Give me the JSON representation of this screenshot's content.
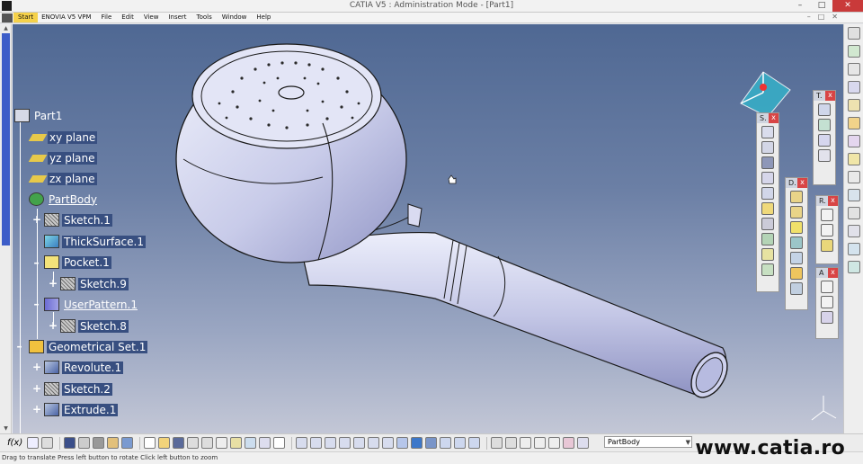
{
  "window": {
    "title": "CATIA V5 : Administration Mode - [Part1]"
  },
  "menu": {
    "items": [
      "Start",
      "ENOVIA V5 VPM",
      "File",
      "Edit",
      "View",
      "Insert",
      "Tools",
      "Window",
      "Help"
    ]
  },
  "tree": {
    "nodes": [
      {
        "id": "part1",
        "label": "Part1",
        "icon": "part-icon"
      },
      {
        "id": "xy",
        "label": "xy plane",
        "icon": "plane-icon"
      },
      {
        "id": "yz",
        "label": "yz plane",
        "icon": "plane-icon"
      },
      {
        "id": "zx",
        "label": "zx plane",
        "icon": "plane-icon"
      },
      {
        "id": "partbody",
        "label": "PartBody",
        "icon": "body-icon"
      },
      {
        "id": "sketch1",
        "label": "Sketch.1",
        "icon": "sketch-icon"
      },
      {
        "id": "thick1",
        "label": "ThickSurface.1",
        "icon": "thick-surface-icon"
      },
      {
        "id": "pocket1",
        "label": "Pocket.1",
        "icon": "pocket-icon"
      },
      {
        "id": "sketch9",
        "label": "Sketch.9",
        "icon": "sketch-icon"
      },
      {
        "id": "pattern1",
        "label": "UserPattern.1",
        "icon": "pattern-icon"
      },
      {
        "id": "sketch8",
        "label": "Sketch.8",
        "icon": "sketch-icon"
      },
      {
        "id": "geoset1",
        "label": "Geometrical Set.1",
        "icon": "geometrical-set-icon"
      },
      {
        "id": "revolute1",
        "label": "Revolute.1",
        "icon": "revolute-icon"
      },
      {
        "id": "sketch2",
        "label": "Sketch.2",
        "icon": "sketch-icon"
      },
      {
        "id": "extrude1",
        "label": "Extrude.1",
        "icon": "extrude-icon"
      }
    ]
  },
  "toolbars": {
    "s": {
      "title": "S."
    },
    "t": {
      "title": "T."
    },
    "d": {
      "title": "D."
    },
    "r": {
      "title": "R."
    },
    "a": {
      "title": "A"
    }
  },
  "bottom": {
    "formula_label": "f(x)",
    "current_body": "PartBody"
  },
  "status": {
    "text": "Drag to translate  Press left button to rotate  Click left button to zoom"
  },
  "watermark": "www.catia.ro",
  "colors": {
    "background_top": "#4f6893",
    "background_bottom": "#c3c7d6",
    "part_surface": "#c9cbe8",
    "tree_highlight": "#384f80"
  }
}
